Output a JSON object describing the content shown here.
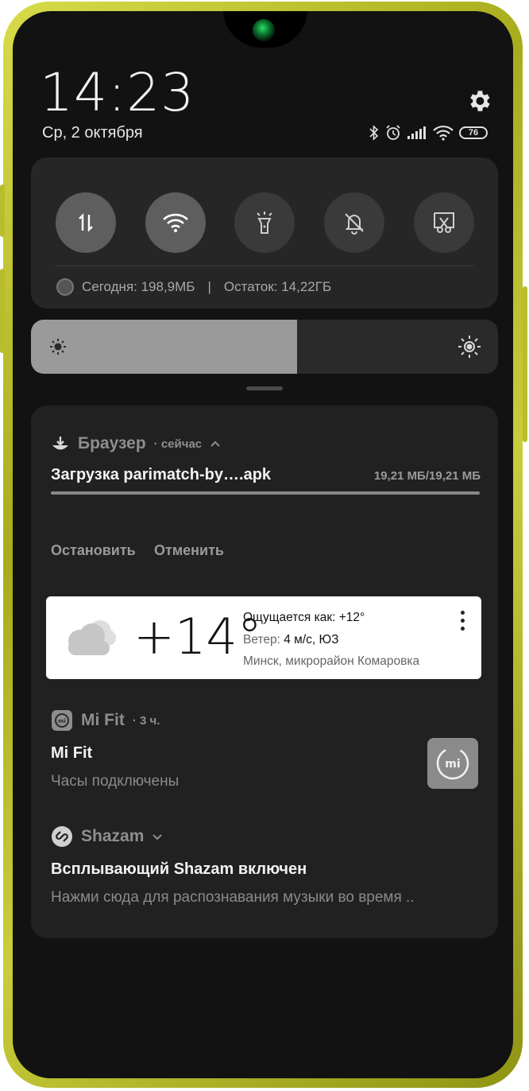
{
  "status_bar": {
    "time": "14:23",
    "date": "Ср, 2 октября",
    "battery": "76"
  },
  "quick_settings": {
    "toggles": [
      {
        "icon": "mobile-data-icon",
        "active": true
      },
      {
        "icon": "wifi-icon",
        "active": true
      },
      {
        "icon": "flashlight-icon",
        "active": false
      },
      {
        "icon": "mute-bell-icon",
        "active": false
      },
      {
        "icon": "screenshot-icon",
        "active": false
      }
    ],
    "data_today": "Сегодня: 198,9МБ",
    "separator": "|",
    "data_remaining": "Остаток: 14,22ГБ"
  },
  "brightness": {
    "level": 0.57
  },
  "notifications": {
    "browser": {
      "app": "Браузер",
      "meta": "· сейчас",
      "title": "Загрузка parimatch-by….apk",
      "size": "19,21 МБ/19,21 МБ",
      "progress": 1.0,
      "actions": [
        "Остановить",
        "Отменить"
      ]
    },
    "weather": {
      "temp": "+14°",
      "feels_like": "Ощущается как: +12°",
      "wind_label": "Ветер:",
      "wind_value": "4 м/с, ЮЗ",
      "location": "Минск, микрорайон Комаровка"
    },
    "mifit": {
      "app": "Mi Fit",
      "meta": "· 3 ч.",
      "title": "Mi Fit",
      "text": "Часы подключены",
      "thumb_label": "mi"
    },
    "shazam": {
      "app": "Shazam",
      "title": "Всплывающий Shazam включен",
      "text": "Нажми сюда для распознавания музыки во время .."
    }
  }
}
